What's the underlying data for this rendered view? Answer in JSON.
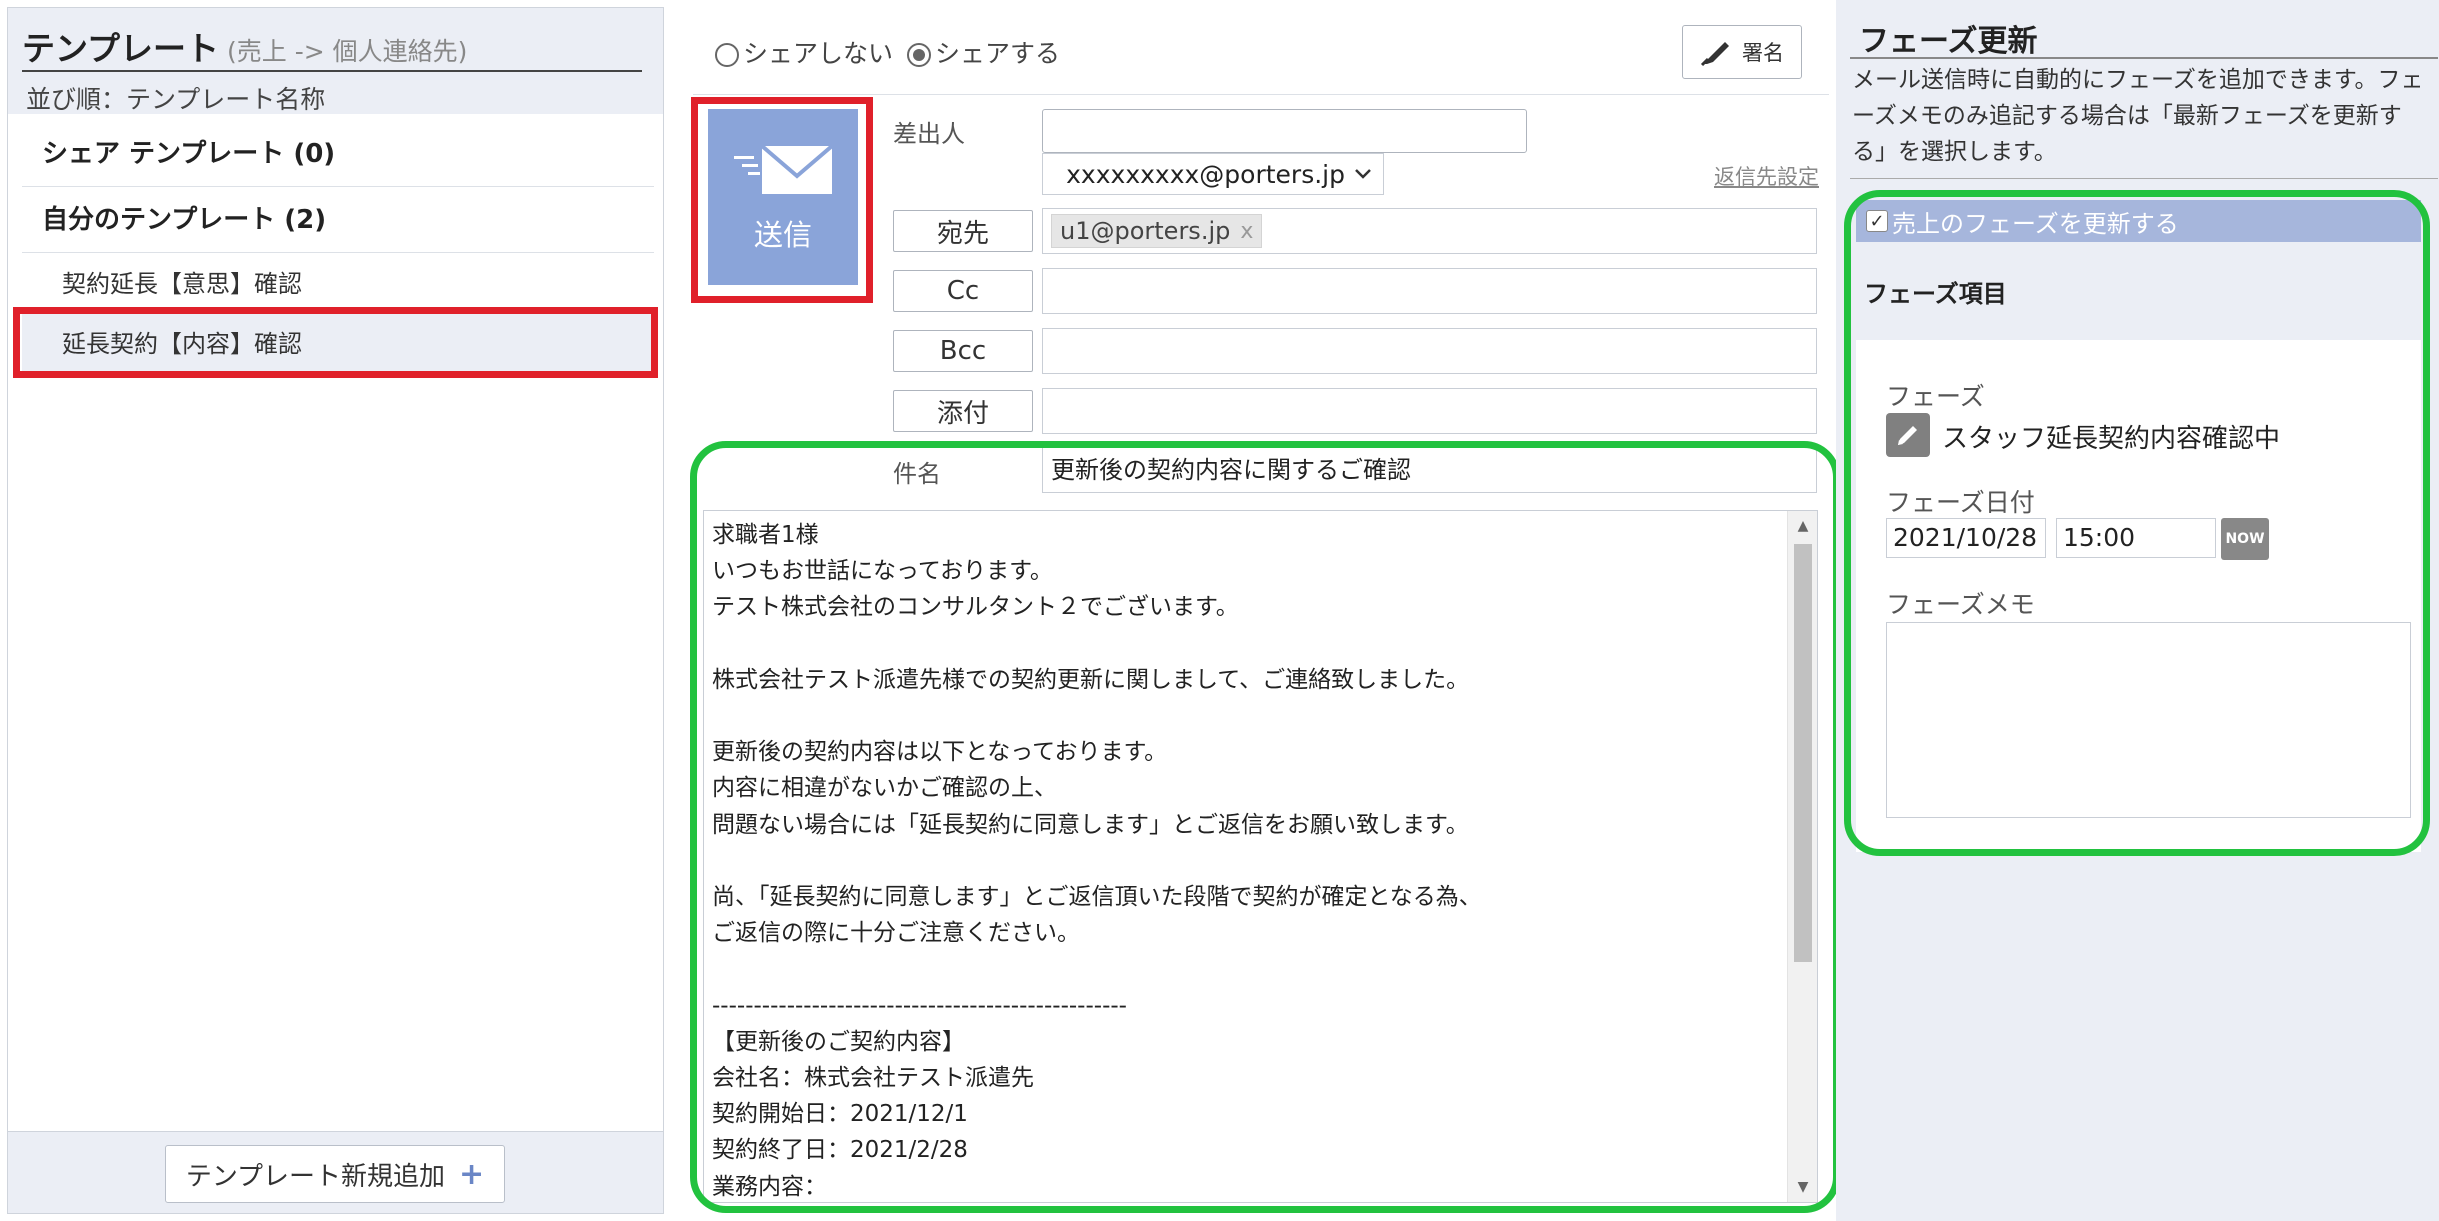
{
  "left_panel": {
    "title": "テンプレート",
    "subtitle": "(売上 -> 個人連絡先)",
    "sort_label": "並び順：テンプレート名称",
    "groups": [
      {
        "label": "シェア テンプレート (0)"
      },
      {
        "label": "自分のテンプレート (2)"
      }
    ],
    "templates": [
      {
        "label": "契約延長【意思】確認"
      },
      {
        "label": "延長契約【内容】確認"
      }
    ],
    "add_button_label": "テンプレート新規追加"
  },
  "compose": {
    "share_options": [
      "シェアしない",
      "シェアする"
    ],
    "share_selected": "シェアする",
    "signature_label": "署名",
    "send_label": "送信",
    "sender_label": "差出人",
    "sender_input_value": "",
    "sender_address": "xxxxxxxxx@porters.jp",
    "reply_settings_label": "返信先設定",
    "to_label": "宛先",
    "to_recipients": [
      "u1@porters.jp"
    ],
    "chip_remove": "x",
    "cc_label": "Cc",
    "bcc_label": "Bcc",
    "attach_label": "添付",
    "subject_label": "件名",
    "subject_value": "更新後の契約内容に関するご確認",
    "body_lines": [
      "求職者1様",
      "いつもお世話になっております。",
      "テスト株式会社のコンサルタント２でございます。",
      "",
      "株式会社テスト派遣先様での契約更新に関しまして、ご連絡致しました。",
      "",
      "更新後の契約内容は以下となっております。",
      "内容に相違がないかご確認の上、",
      "問題ない場合には「延長契約に同意します」とご返信をお願い致します。",
      "",
      "尚、「延長契約に同意します」とご返信頂いた段階で契約が確定となる為、",
      "ご返信の際に十分ご注意ください。",
      "",
      "--------------------------------------------------",
      "【更新後のご契約内容】",
      "会社名：株式会社テスト派遣先",
      "契約開始日：2021/12/1",
      "契約終了日：2021/2/28",
      "業務内容："
    ]
  },
  "phase_panel": {
    "title": "フェーズ更新",
    "description": "メール送信時に自動的にフェーズを追加できます。フェーズメモのみ追記する場合は「最新フェーズを更新する」を選択します。",
    "update_checkbox_label": "売上のフェーズを更新する",
    "update_checked": true,
    "items_label": "フェーズ項目",
    "phase_label": "フェーズ",
    "phase_value": "スタッフ延長契約内容確認中",
    "date_label": "フェーズ日付",
    "date_value": "2021/10/28",
    "time_value": "15:00",
    "now_label": "NOW",
    "memo_label": "フェーズメモ",
    "memo_value": ""
  },
  "colors": {
    "highlight_red": "#e0202a",
    "highlight_green": "#22c23f",
    "send_button": "#8aa4d9",
    "panel_bg": "#ebeef5"
  },
  "icons": {
    "signature": "pen-icon",
    "send": "envelope-icon",
    "add": "plus-icon",
    "phase_edit": "pencil-icon"
  }
}
